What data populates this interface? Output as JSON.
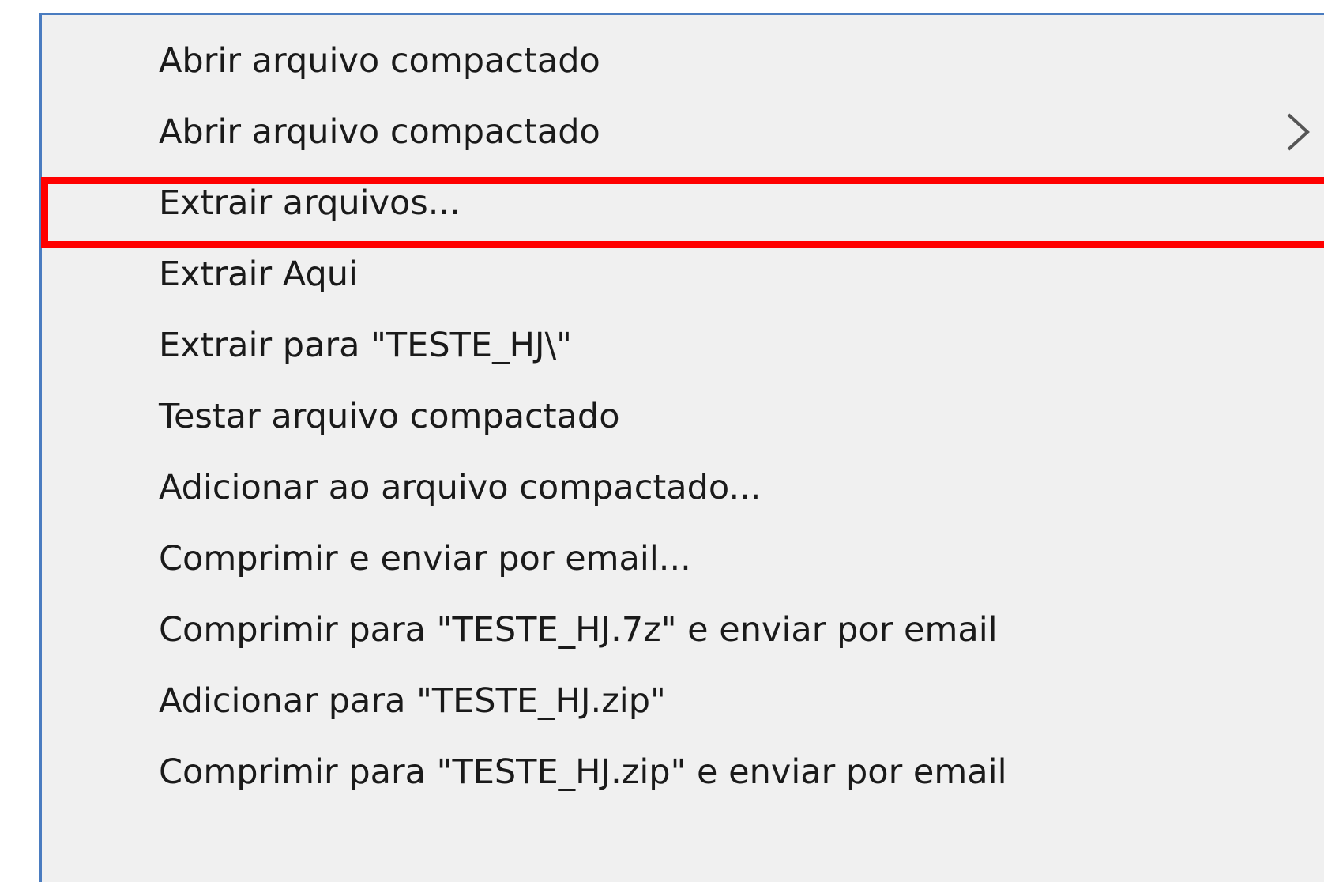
{
  "context_menu": {
    "items": [
      {
        "label": "Abrir arquivo compactado",
        "has_submenu": false
      },
      {
        "label": "Abrir arquivo compactado",
        "has_submenu": true
      },
      {
        "label": "Extrair arquivos...",
        "has_submenu": false,
        "highlighted": true
      },
      {
        "label": "Extrair Aqui",
        "has_submenu": false
      },
      {
        "label": "Extrair para \"TESTE_HJ\\\"",
        "has_submenu": false
      },
      {
        "label": "Testar arquivo compactado",
        "has_submenu": false
      },
      {
        "label": "Adicionar ao arquivo compactado...",
        "has_submenu": false
      },
      {
        "label": "Comprimir e enviar por email...",
        "has_submenu": false
      },
      {
        "label": "Comprimir para \"TESTE_HJ.7z\" e enviar por email",
        "has_submenu": false
      },
      {
        "label": "Adicionar para \"TESTE_HJ.zip\"",
        "has_submenu": false
      },
      {
        "label": "Comprimir para \"TESTE_HJ.zip\" e enviar por email",
        "has_submenu": false
      }
    ],
    "submenu_icon": "chevron-right-icon",
    "colors": {
      "menu_background": "#f0f0f0",
      "menu_border": "#4a7cc0",
      "highlight_annotation": "#ff0000",
      "text": "#1a1a1a"
    }
  }
}
